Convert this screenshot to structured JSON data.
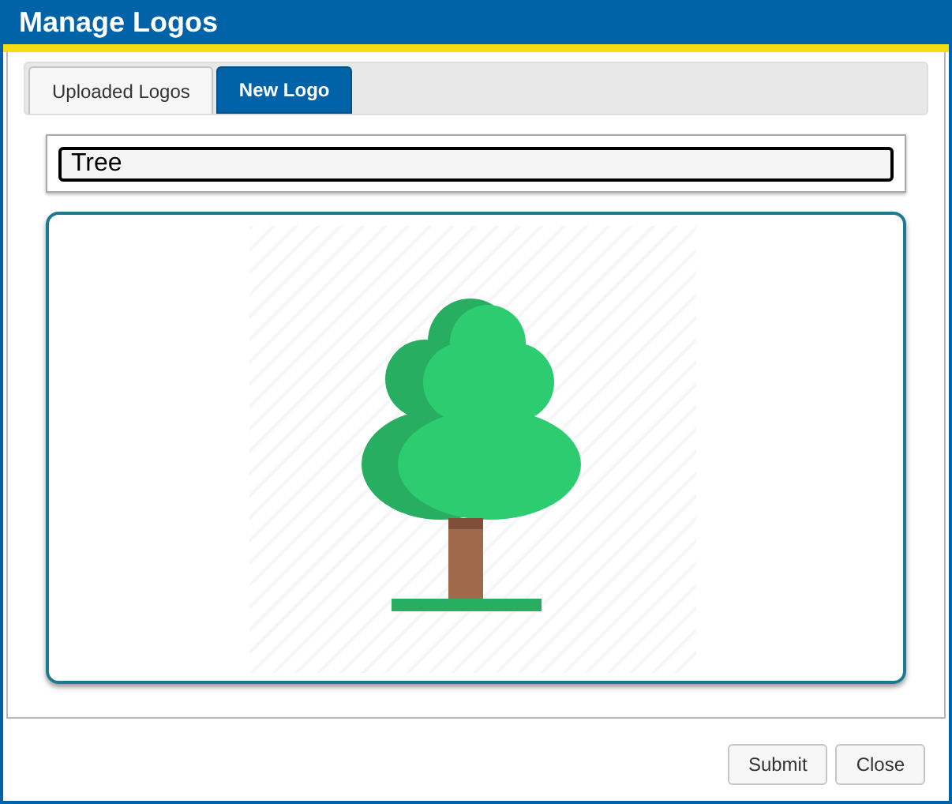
{
  "window": {
    "title": "Manage Logos"
  },
  "tabs": [
    {
      "label": "Uploaded Logos",
      "selected": false
    },
    {
      "label": "New Logo",
      "selected": true
    }
  ],
  "name_field": {
    "value": "Tree"
  },
  "buttons": [
    "Submit",
    "Close"
  ]
}
